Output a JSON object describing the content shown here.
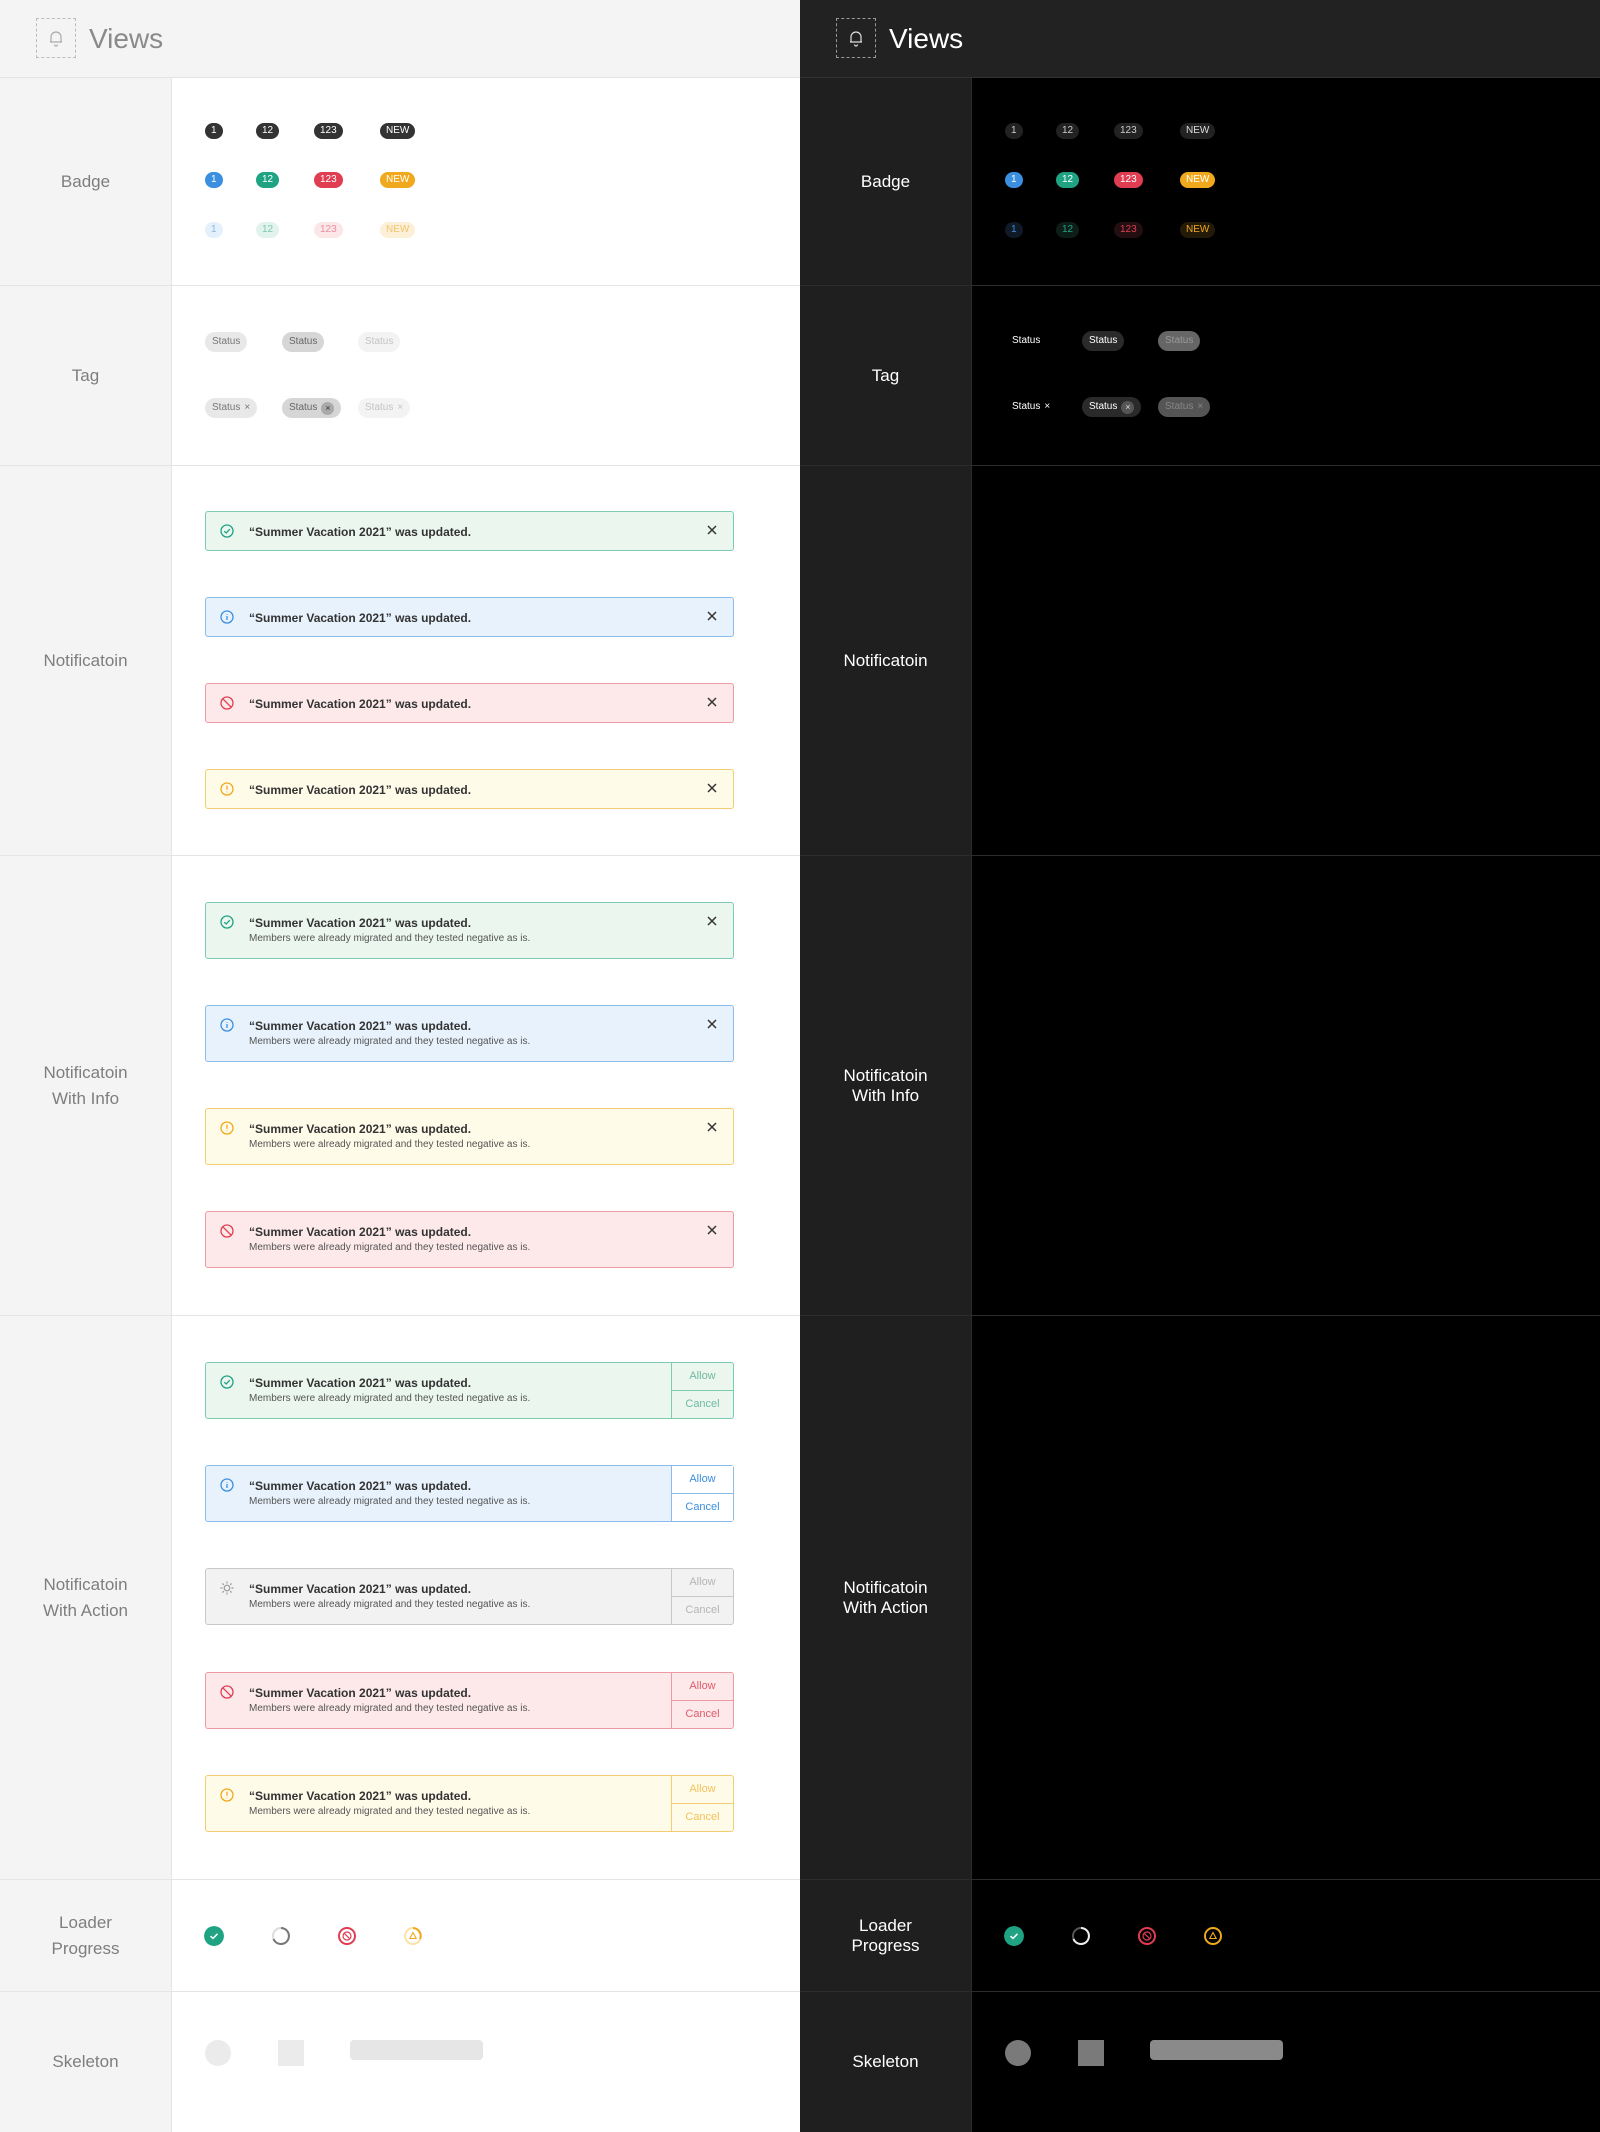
{
  "header": {
    "title": "Views",
    "icon": "bell-icon"
  },
  "rows": {
    "badge": "Badge",
    "tag": "Tag",
    "notification": "Notificatoin",
    "notification_info_1": "Notificatoin",
    "notification_info_2": "With Info",
    "notification_action_1": "Notificatoin",
    "notification_action_2": "With Action",
    "loader_1": "Loader",
    "loader_2": "Progress",
    "skeleton": "Skeleton"
  },
  "badges": {
    "one": "1",
    "twelve": "12",
    "three": "123",
    "new": "NEW"
  },
  "tags": {
    "label": "Status",
    "close": "×"
  },
  "notification": {
    "title": "“Summer Vacation 2021” was updated.",
    "subtitle": "Members were already migrated and they tested negative as is.",
    "allow": "Allow",
    "cancel": "Cancel"
  },
  "colors": {
    "success": "#1fa383",
    "info": "#3b8fe0",
    "error": "#e03d52",
    "warning": "#f0a81c",
    "neutral": "#8a8a8a"
  }
}
